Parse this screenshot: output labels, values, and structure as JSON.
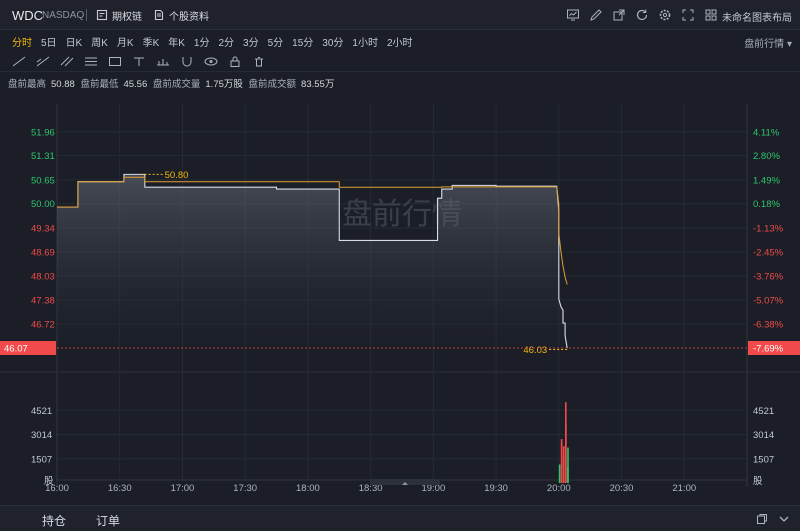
{
  "header": {
    "ticker": "WDC",
    "exchange": "NASDAQ",
    "buttons": [
      {
        "name": "rights-chain-button",
        "icon": "chain-doc-icon",
        "label": "期权链"
      },
      {
        "name": "stock-profile-button",
        "icon": "document-icon",
        "label": "个股资料"
      }
    ],
    "tool_icons": [
      "indicator-icon",
      "draw-icon",
      "share-icon",
      "refresh-icon",
      "settings-icon",
      "fullscreen-icon",
      "grid-layout-icon"
    ],
    "layout_label": "未命名图表布局"
  },
  "periods": {
    "items": [
      "分时",
      "5日",
      "日K",
      "周K",
      "月K",
      "季K",
      "年K",
      "1分",
      "2分",
      "3分",
      "5分",
      "15分",
      "30分",
      "1小时",
      "2小时"
    ],
    "active": "分时",
    "premarket_label": "盘前行情"
  },
  "info": {
    "high_label": "盘前最高",
    "high_value": "50.88",
    "low_label": "盘前最低",
    "low_value": "45.56",
    "volume_label": "盘前成交量",
    "volume_value": "1.75万股",
    "turnover_label": "盘前成交额",
    "turnover_value": "83.55万"
  },
  "chart_data": {
    "type": "line",
    "watermark": "盘前行情",
    "x_ticks": [
      "16:00",
      "16:30",
      "17:00",
      "17:30",
      "18:00",
      "18:30",
      "19:00",
      "19:30",
      "20:00",
      "20:30",
      "21:00"
    ],
    "price_ticks": [
      "51.96",
      "51.31",
      "50.65",
      "50.00",
      "49.34",
      "48.69",
      "48.03",
      "47.38",
      "46.72"
    ],
    "pct_ticks": [
      "4.11%",
      "2.80%",
      "1.49%",
      "0.18%",
      "-1.13%",
      "-2.45%",
      "-3.76%",
      "-5.07%",
      "-6.38%"
    ],
    "ylim": [
      46.07,
      52.39
    ],
    "reference_price": 49.91,
    "current_price": "46.07",
    "current_pct": "-7.69%",
    "annotations": {
      "high": "50.80",
      "low": "46.03"
    },
    "volume_ticks": [
      "4521",
      "3014",
      "1507"
    ],
    "volume_unit": "股",
    "volume_max": 6028,
    "colors": {
      "price": "#d9dde6",
      "avg": "#e0a032",
      "up": "#2fc46f",
      "down": "#f04a4a",
      "current": "#f04a4a"
    },
    "series": [
      {
        "name": "price",
        "x": [
          "16:00",
          "16:10",
          "16:10",
          "16:32",
          "16:32",
          "16:42",
          "16:42",
          "17:45",
          "17:45",
          "18:15",
          "18:15",
          "18:44",
          "18:44",
          "19:02",
          "19:02",
          "19:04",
          "19:04",
          "19:09",
          "19:09",
          "19:30",
          "19:30",
          "19:59",
          "20:00",
          "20:00",
          "20:01",
          "20:02",
          "20:02",
          "20:03",
          "20:03",
          "20:04"
        ],
        "values": [
          49.91,
          49.91,
          50.6,
          50.6,
          50.8,
          50.8,
          50.45,
          50.45,
          50.4,
          50.4,
          49.0,
          49.0,
          49.0,
          49.0,
          50.15,
          50.15,
          50.4,
          50.4,
          50.5,
          50.5,
          50.48,
          50.48,
          49.8,
          47.4,
          47.2,
          47.1,
          46.75,
          46.75,
          46.4,
          46.07
        ]
      },
      {
        "name": "avg",
        "x": [
          "16:00",
          "16:10",
          "16:10",
          "16:32",
          "16:32",
          "16:42",
          "16:42",
          "18:15",
          "18:15",
          "19:04",
          "19:04",
          "19:59",
          "20:00",
          "20:00",
          "20:01",
          "20:02",
          "20:03",
          "20:04"
        ],
        "values": [
          49.91,
          49.91,
          50.6,
          50.6,
          50.72,
          50.72,
          50.6,
          50.6,
          50.45,
          50.45,
          50.46,
          50.46,
          50.0,
          49.2,
          48.7,
          48.3,
          48.0,
          47.8
        ]
      }
    ],
    "volume": [
      {
        "x": "20:00",
        "value": 1150,
        "dir": "up"
      },
      {
        "x": "20:00",
        "value": 2730,
        "dir": "down"
      },
      {
        "x": "20:01",
        "value": 2520,
        "dir": "down"
      },
      {
        "x": "20:01",
        "value": 1530,
        "dir": "up"
      },
      {
        "x": "20:02",
        "value": 2290,
        "dir": "down"
      },
      {
        "x": "20:02",
        "value": 5020,
        "dir": "down"
      },
      {
        "x": "20:03",
        "value": 3750,
        "dir": "down"
      },
      {
        "x": "20:03",
        "value": 1000,
        "dir": "up"
      },
      {
        "x": "20:04",
        "value": 2200,
        "dir": "up"
      }
    ]
  },
  "bottom": {
    "tabs": [
      "持仓",
      "订单"
    ],
    "icons": [
      "copy-icon",
      "collapse-icon"
    ]
  }
}
